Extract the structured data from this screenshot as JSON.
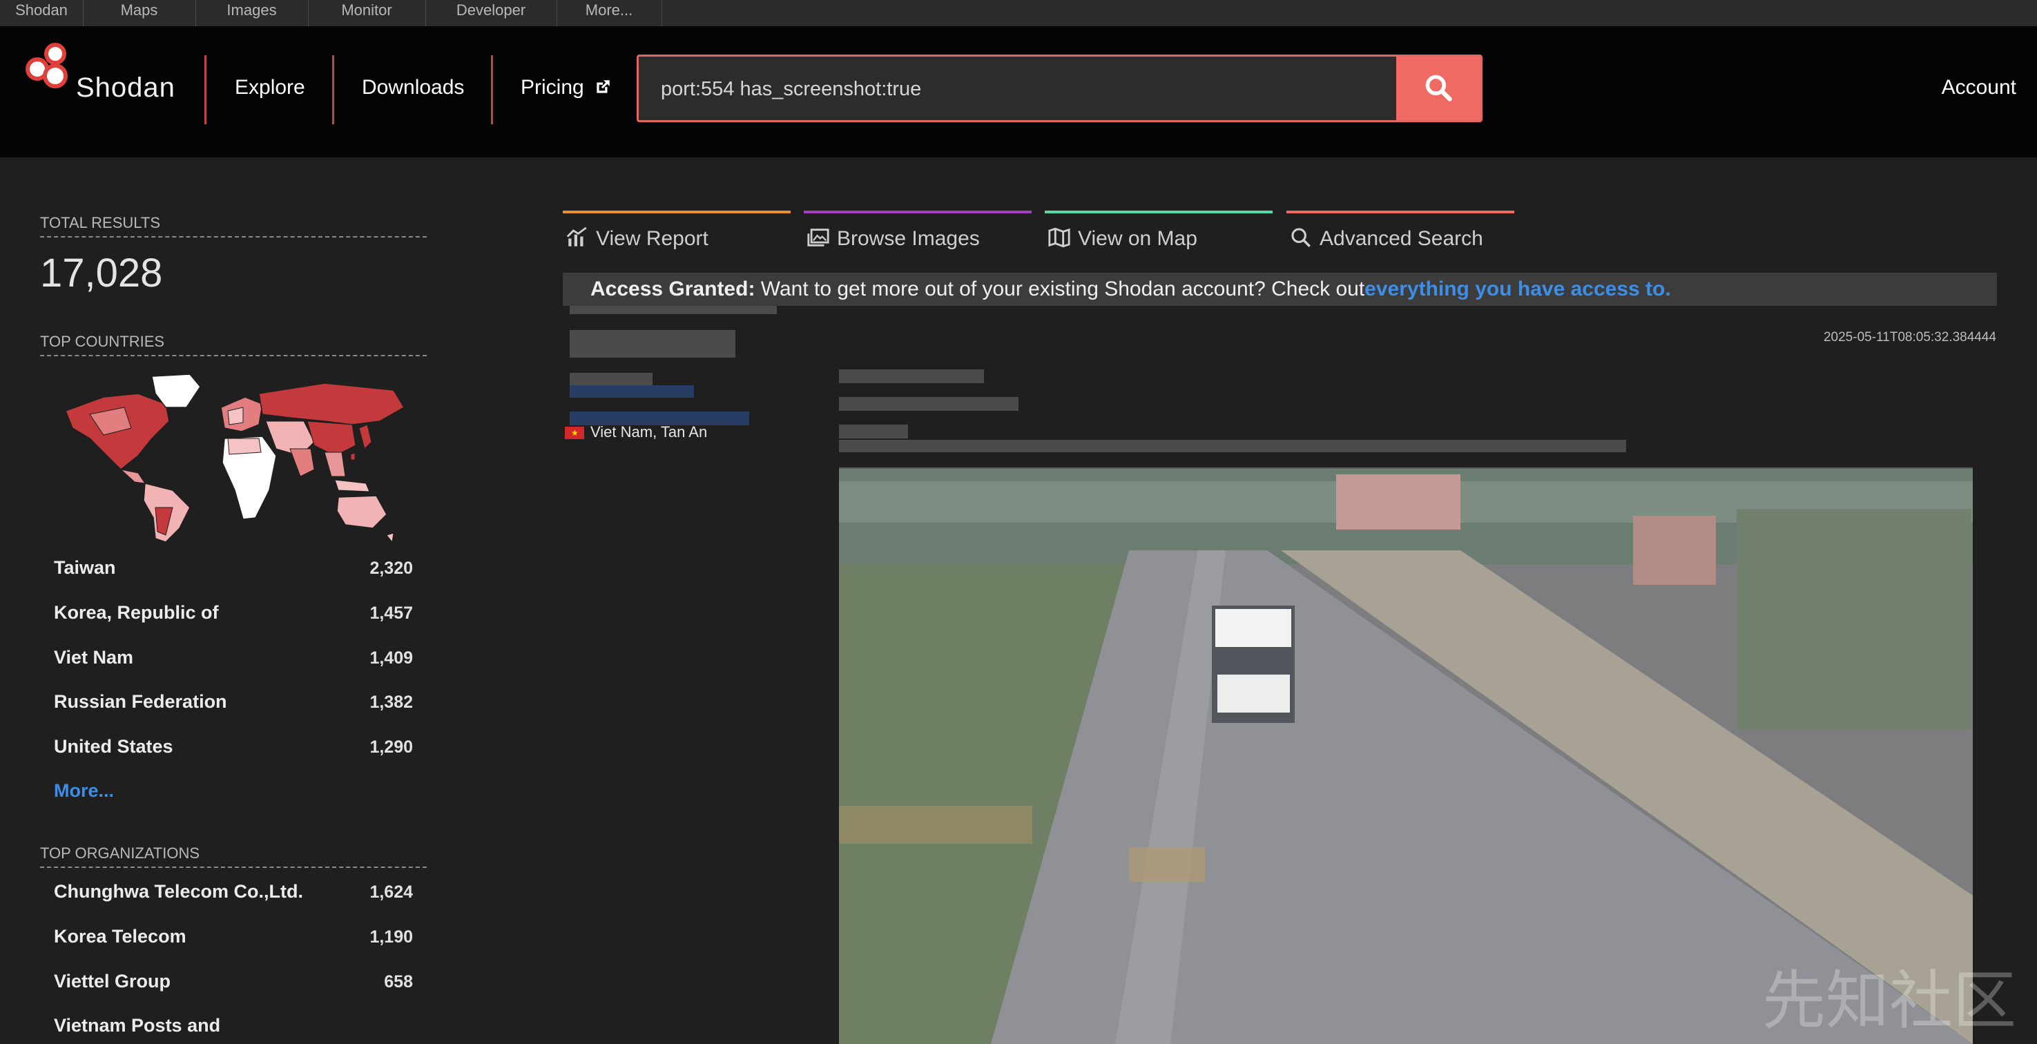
{
  "topbar": {
    "items": [
      "Shodan",
      "Maps",
      "Images",
      "Monitor",
      "Developer",
      "More..."
    ]
  },
  "header": {
    "brand": "Shodan",
    "nav": [
      "Explore",
      "Downloads",
      "Pricing"
    ],
    "search_value": "port:554 has_screenshot:true",
    "account": "Account",
    "accent_color": "#ee6a62"
  },
  "sidebar": {
    "total_label": "TOTAL RESULTS",
    "total_value": "17,028",
    "countries_label": "TOP COUNTRIES",
    "countries": [
      {
        "name": "Taiwan",
        "count": "2,320"
      },
      {
        "name": "Korea, Republic of",
        "count": "1,457"
      },
      {
        "name": "Viet Nam",
        "count": "1,409"
      },
      {
        "name": "Russian Federation",
        "count": "1,382"
      },
      {
        "name": "United States",
        "count": "1,290"
      }
    ],
    "more": "More...",
    "orgs_label": "TOP ORGANIZATIONS",
    "orgs": [
      {
        "name": "Chunghwa Telecom Co.,Ltd.",
        "count": "1,624"
      },
      {
        "name": "Korea Telecom",
        "count": "1,190"
      },
      {
        "name": "Viettel Group",
        "count": "658"
      },
      {
        "name": "Vietnam Posts and",
        "count": ""
      }
    ]
  },
  "tabs": [
    {
      "label": "View Report",
      "icon": "chart-icon",
      "color": "#e8922e"
    },
    {
      "label": "Browse Images",
      "icon": "images-icon",
      "color": "#a43ec1"
    },
    {
      "label": "View on Map",
      "icon": "map-icon",
      "color": "#57d9a3"
    },
    {
      "label": "Advanced Search",
      "icon": "search-icon",
      "color": "#ee6a62"
    }
  ],
  "banner": {
    "strong": "Access Granted:",
    "text": " Want to get more out of your existing Shodan account? Check out",
    "link": "everything you have access to."
  },
  "result": {
    "timestamp": "2025-05-11T08:05:32.384444",
    "location": "Viet Nam, Tan An"
  },
  "watermark": "先知社区"
}
